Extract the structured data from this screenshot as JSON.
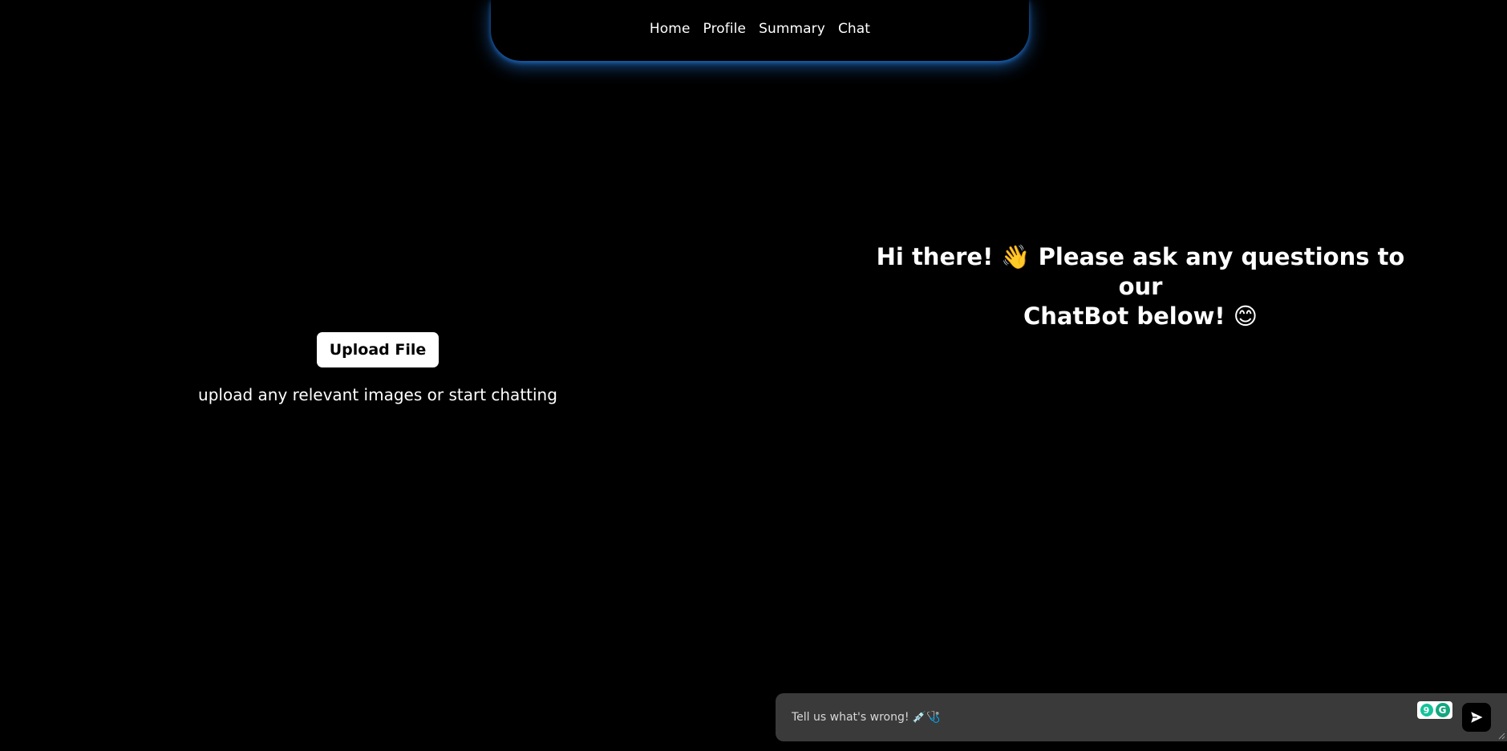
{
  "nav": {
    "items": [
      {
        "label": "Home"
      },
      {
        "label": "Profile"
      },
      {
        "label": "Summary"
      },
      {
        "label": "Chat"
      }
    ]
  },
  "upload": {
    "button_label": "Upload File",
    "hint": "upload any relevant images or start chatting"
  },
  "greeting": {
    "line1": "Hi there! 👋 Please ask any questions to our",
    "line2": "ChatBot below! 😊"
  },
  "chat": {
    "placeholder": "Tell us what's wrong! 💉🩺",
    "value": "",
    "send_icon": "send-arrow-icon",
    "grammar_count": "9",
    "grammar_letter": "G"
  },
  "colors": {
    "background": "#000000",
    "nav_glow": "#288cff",
    "input_bg": "#3a3a3a",
    "grammarly": "#15c39a"
  }
}
